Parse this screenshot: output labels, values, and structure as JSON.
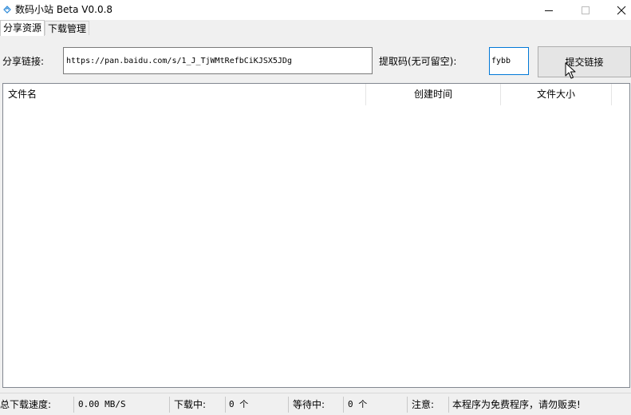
{
  "window": {
    "title": "数码小站 Beta V0.0.8",
    "controls": {
      "minimize": "—",
      "maximize": "☐",
      "close": "✕"
    }
  },
  "tabs": [
    {
      "label": "分享资源",
      "active": true
    },
    {
      "label": "下载管理",
      "active": false
    }
  ],
  "share": {
    "link_label": "分享链接:",
    "link_value": "https://pan.baidu.com/s/1_J_TjWMtRefbCiKJSX5JDg",
    "code_label": "提取码(无可留空):",
    "code_value": "fybb",
    "submit_label": "提交链接"
  },
  "file_list": {
    "columns": [
      "文件名",
      "创建时间",
      "文件大小"
    ],
    "rows": []
  },
  "status": {
    "total_speed_label": "总下载速度:",
    "total_speed_value": "0.00 MB/S",
    "downloading_label": "下载中:",
    "downloading_value": "0 个",
    "waiting_label": "等待中:",
    "waiting_value": "0 个",
    "notice_label": "注意:",
    "notice_value": "本程序为免费程序，请勿贩卖!"
  },
  "colors": {
    "focus_border": "#0078d7",
    "button_bg": "#e5e5e5",
    "window_bg": "#f0f0f0"
  },
  "icons": [
    "app-icon",
    "minimize-icon",
    "maximize-icon",
    "close-icon",
    "mouse-cursor-icon"
  ]
}
